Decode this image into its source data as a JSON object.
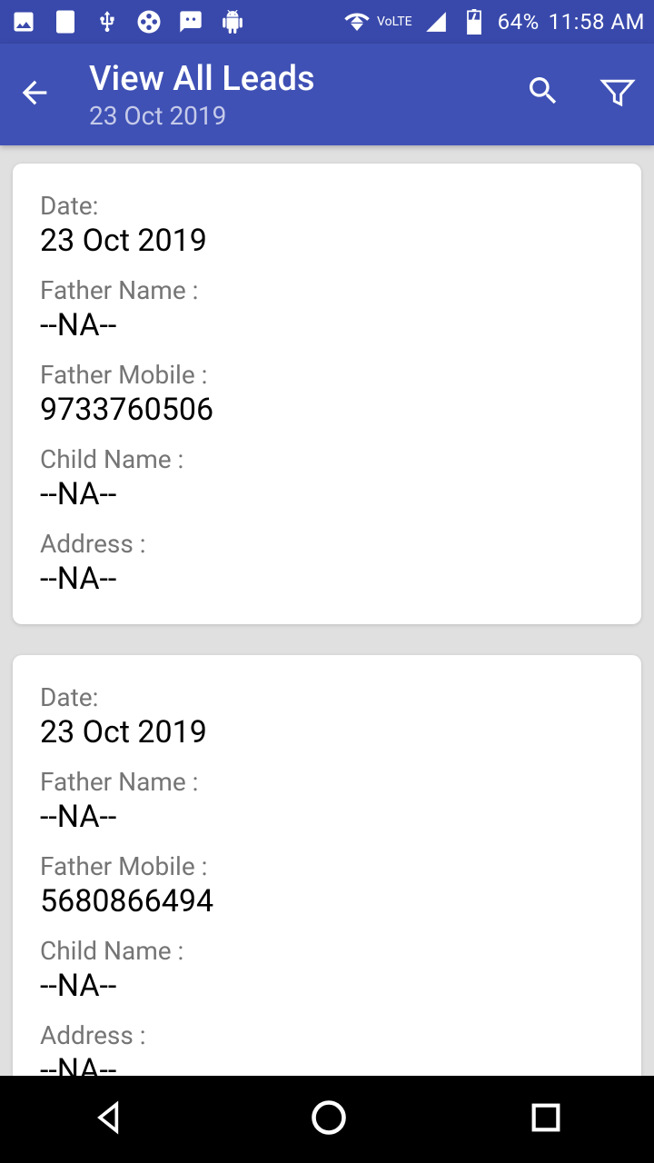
{
  "status": {
    "battery": "64%",
    "time": "11:58 AM",
    "volte": "VoLTE"
  },
  "header": {
    "title": "View All Leads",
    "subtitle": "23 Oct 2019"
  },
  "labels": {
    "date": "Date:",
    "father_name": "Father Name :",
    "father_mobile": "Father Mobile :",
    "child_name": "Child Name :",
    "address": "Address :"
  },
  "leads": [
    {
      "date": "23 Oct 2019",
      "father_name": "--NA--",
      "father_mobile": "9733760506",
      "child_name": "--NA--",
      "address": "--NA--"
    },
    {
      "date": "23 Oct 2019",
      "father_name": "--NA--",
      "father_mobile": "5680866494",
      "child_name": "--NA--",
      "address": "--NA--"
    }
  ]
}
